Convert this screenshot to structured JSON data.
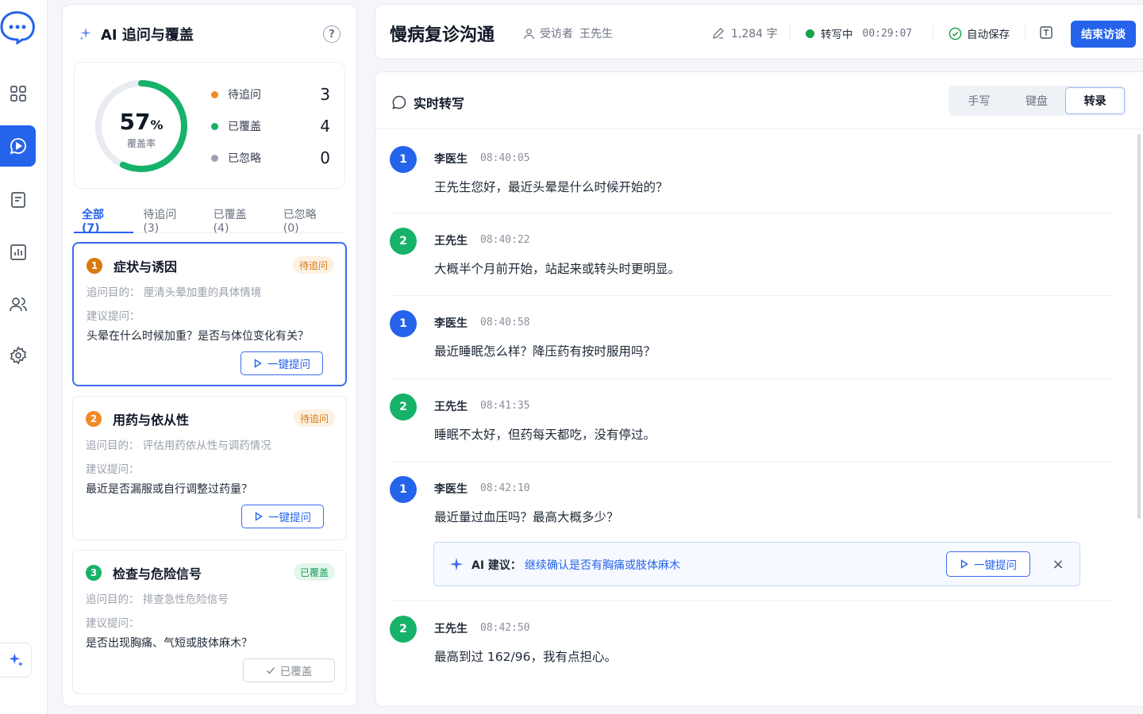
{
  "colors": {
    "accent": "#2563eb",
    "pending": "#f08a24",
    "covered": "#16b26a",
    "ignored": "#9ca3af"
  },
  "rail": {
    "items": [
      {
        "name": "dashboard-grid-icon"
      },
      {
        "name": "chat-play-icon"
      },
      {
        "name": "document-icon"
      },
      {
        "name": "bar-chart-icon"
      },
      {
        "name": "users-icon"
      },
      {
        "name": "settings-gear-icon"
      }
    ],
    "active_index": 1
  },
  "ai_panel": {
    "title": "AI 追问与覆盖",
    "coverage": {
      "percent": "57",
      "unit": "%",
      "label": "覆盖率",
      "fraction": 0.57
    },
    "stats": [
      {
        "label": "待追问",
        "value": "3",
        "color": "#f08a24"
      },
      {
        "label": "已覆盖",
        "value": "4",
        "color": "#16b26a"
      },
      {
        "label": "已忽略",
        "value": "0",
        "color": "#9ca3af"
      }
    ],
    "tabs": [
      {
        "label": "全部 (7)"
      },
      {
        "label": "待追问 (3)"
      },
      {
        "label": "已覆盖 (4)"
      },
      {
        "label": "已忽略 (0)"
      }
    ],
    "cards": [
      {
        "num": "1",
        "title": "症状与诱因",
        "badge": "待追问",
        "purpose_label": "追问目的：",
        "purpose": "厘清头晕加重的具体情境",
        "sugg_label": "建议提问：",
        "question": "头晕在什么时候加重？是否与体位变化有关？",
        "button": "一键提问"
      },
      {
        "num": "2",
        "title": "用药与依从性",
        "badge": "待追问",
        "purpose_label": "追问目的：",
        "purpose": "评估用药依从性与调药情况",
        "sugg_label": "建议提问：",
        "question": "最近是否漏服或自行调整过药量？",
        "button": "一键提问"
      },
      {
        "num": "3",
        "title": "检查与危险信号",
        "badge": "已覆盖",
        "purpose_label": "追问目的：",
        "purpose": "排查急性危险信号",
        "sugg_label": "建议提问：",
        "question": "是否出现胸痛、气短或肢体麻木？",
        "button": "已覆盖"
      }
    ]
  },
  "header": {
    "title": "慢病复诊沟通",
    "interviewee_label": "受访者",
    "interviewee_name": "王先生",
    "word_count": "1,284 字",
    "status": "转写中",
    "elapsed": "00:29:07",
    "autosave": "自动保存",
    "end_button": "结束访谈"
  },
  "transcript": {
    "title": "实时转写",
    "modes": [
      "手写",
      "键盘",
      "转录"
    ],
    "active_mode": 2,
    "messages": [
      {
        "avatar": "1",
        "speaker": "李医生",
        "time": "08:40:05",
        "text": "王先生您好，最近头晕是什么时候开始的？"
      },
      {
        "avatar": "2",
        "speaker": "王先生",
        "time": "08:40:22",
        "text": "大概半个月前开始，站起来或转头时更明显。"
      },
      {
        "avatar": "1",
        "speaker": "李医生",
        "time": "08:40:58",
        "text": "最近睡眠怎么样？降压药有按时服用吗？"
      },
      {
        "avatar": "2",
        "speaker": "王先生",
        "time": "08:41:35",
        "text": "睡眠不太好，但药每天都吃，没有停过。"
      },
      {
        "avatar": "1",
        "speaker": "李医生",
        "time": "08:42:10",
        "text": "最近量过血压吗？最高大概多少？"
      },
      {
        "avatar": "2",
        "speaker": "王先生",
        "time": "08:42:50",
        "text": "最高到过 162/96，我有点担心。"
      }
    ],
    "ai_suggestion": {
      "label": "AI 建议：",
      "text": "继续确认是否有胸痛或肢体麻木",
      "button": "一键提问"
    }
  }
}
